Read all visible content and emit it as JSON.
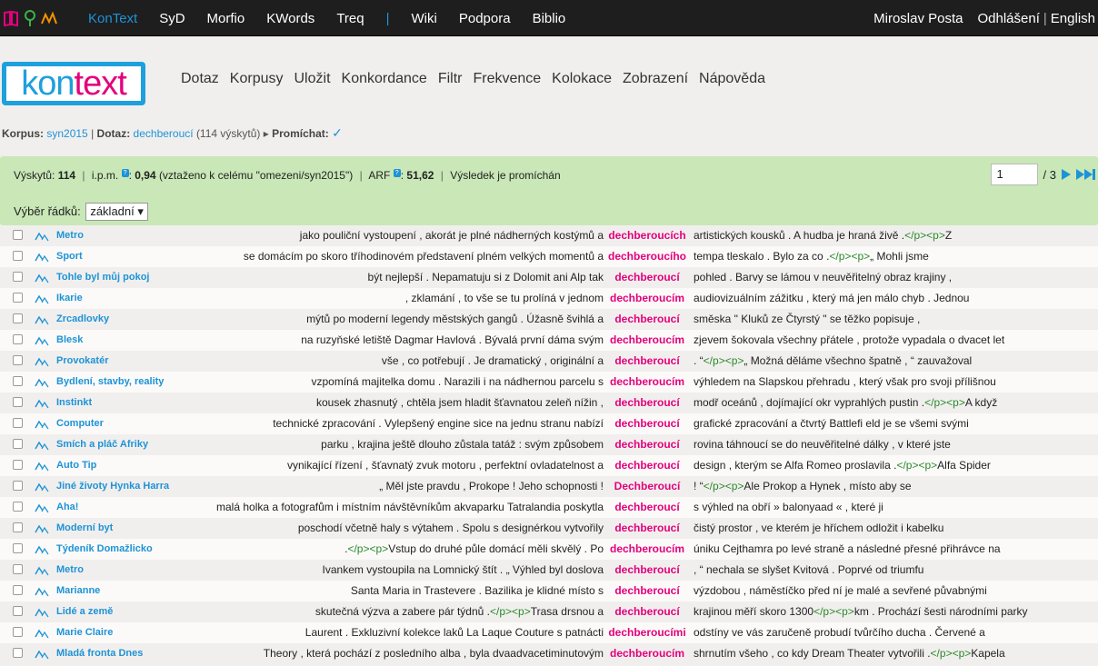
{
  "topbar": {
    "nav": [
      {
        "label": "KonText",
        "active": true
      },
      {
        "label": "SyD",
        "active": false
      },
      {
        "label": "Morfio",
        "active": false
      },
      {
        "label": "KWords",
        "active": false
      },
      {
        "label": "Treq",
        "active": false
      },
      {
        "label": "|",
        "separator": true
      },
      {
        "label": "Wiki",
        "active": false
      },
      {
        "label": "Podpora",
        "active": false
      },
      {
        "label": "Biblio",
        "active": false
      }
    ],
    "user": "Miroslav Posta",
    "logout": "Odhlášení",
    "pipe": "|",
    "language": "English"
  },
  "brand": {
    "kon": "kon",
    "text": "text"
  },
  "menu": [
    "Dotaz",
    "Korpusy",
    "Uložit",
    "Konkordance",
    "Filtr",
    "Frekvence",
    "Kolokace",
    "Zobrazení",
    "Nápověda"
  ],
  "breadcrumb": {
    "corpus_label": "Korpus:",
    "corpus": "syn2015",
    "query_label": "Dotaz:",
    "query": "dechberoucí",
    "query_count": "(114 výskytů)",
    "shuffle_label": "Promíchat:",
    "shuffle_mark": "✓"
  },
  "summary": {
    "hits_label": "Výskytů:",
    "hits": "114",
    "ipm_label": "i.p.m.",
    "ipm": "0,94",
    "ipm_note": "(vztaženo k celému \"omezeni/syn2015\")",
    "arf_label": "ARF",
    "arf": "51,62",
    "shuffled": "Výsledek je promíchán",
    "line_select_label": "Výběr řádků:",
    "line_select_value": "základní ▾"
  },
  "pager": {
    "current": "1",
    "total": "/ 3"
  },
  "rows": [
    {
      "ref": "Metro",
      "left": "jako pouliční vystoupení , akorát je plné nádherných kostýmů a",
      "kwic": "dechberoucích",
      "right": "artistických kousků . A hudba je hraná živě .</p><p>Z"
    },
    {
      "ref": "Sport",
      "left": "se domácím po skoro tříhodinovém představení plném velkých momentů a",
      "kwic": "dechberoucího",
      "right": "tempa tleskalo . Bylo za co .</p><p>„ Mohli jsme"
    },
    {
      "ref": "Tohle byl můj pokoj",
      "left": "být nejlepší . Nepamatuju si z Dolomit ani Alp tak",
      "kwic": "dechberoucí",
      "right": "pohled . Barvy se lámou v neuvěřitelný obraz krajiny ,"
    },
    {
      "ref": "Ikarie",
      "left": ", zklamání , to vše se tu prolíná v jednom",
      "kwic": "dechberoucím",
      "right": "audiovizuálním zážitku , který má jen málo chyb . Jednou"
    },
    {
      "ref": "Zrcadlovky",
      "left": "mýtů po moderní legendy městských gangů . Úžasně švihlá a",
      "kwic": "dechberoucí",
      "right": "směska \" Kluků ze Čtyrstý \" se těžko popisuje ,"
    },
    {
      "ref": "Blesk",
      "left": "na ruzyňské letiště Dagmar Havlová . Bývalá první dáma svým",
      "kwic": "dechberoucím",
      "right": "zjevem šokovala všechny přátele , protože vypadala o dvacet let"
    },
    {
      "ref": "Provokatér",
      "left": "vše , co potřebují . Je dramatický , originální a",
      "kwic": "dechberoucí",
      "right": ". “</p><p>„ Možná děláme všechno špatně , “ zauvažoval"
    },
    {
      "ref": "Bydlení, stavby, reality",
      "left": "vzpomíná majitelka domu . Narazili i na nádhernou parcelu s",
      "kwic": "dechberoucím",
      "right": "výhledem na Slapskou přehradu , který však pro svoji přílišnou"
    },
    {
      "ref": "Instinkt",
      "left": "kousek zhasnutý , chtěla jsem hladit šťavnatou zeleň nížin ,",
      "kwic": "dechberoucí",
      "right": "modř oceánů , dojímající okr vyprahlých pustin .</p><p>A když"
    },
    {
      "ref": "Computer",
      "left": "technické zpracování . Vylepšený engine sice na jednu stranu nabízí",
      "kwic": "dechberoucí",
      "right": "grafické zpracování a čtvrtý Battlefi eld je se všemi svými"
    },
    {
      "ref": "Smích a pláč Afriky",
      "left": "parku , krajina ještě dlouho zůstala tatáž : svým způsobem",
      "kwic": "dechberoucí",
      "right": "rovina táhnoucí se do neuvěřitelné dálky , v které jste"
    },
    {
      "ref": "Auto Tip",
      "left": "vynikající řízení , šťavnatý zvuk motoru , perfektní ovladatelnost a",
      "kwic": "dechberoucí",
      "right": "design , kterým se Alfa Romeo proslavila .</p><p>Alfa Spider"
    },
    {
      "ref": "Jiné životy Hynka Harra",
      "left": "„ Měl jste pravdu , Prokope ! Jeho schopnosti !",
      "kwic": "Dechberoucí",
      "right": "! “</p><p>Ale Prokop a Hynek , místo aby se"
    },
    {
      "ref": "Aha!",
      "left": "malá holka a fotografům i místním návštěvníkům akvaparku Tatralandia poskytla",
      "kwic": "dechberoucí",
      "right": "s výhled na obří » balonyaad « , které ji"
    },
    {
      "ref": "Moderní byt",
      "left": "poschodí včetně haly s výtahem . Spolu s designérkou vytvořily",
      "kwic": "dechberoucí",
      "right": "čistý prostor , ve kterém je hříchem odložit i kabelku"
    },
    {
      "ref": "Týdeník Domažlicko",
      "left": ".</p><p>Vstup do druhé půle domácí měli skvělý . Po",
      "kwic": "dechberoucím",
      "right": "úniku Cejthamra po levé straně a následné přesné přihrávce na"
    },
    {
      "ref": "Metro",
      "left": "Ivankem vystoupila na Lomnický štít . „ Výhled byl doslova",
      "kwic": "dechberoucí",
      "right": ", “ nechala se slyšet Kvitová . Poprvé od triumfu"
    },
    {
      "ref": "Marianne",
      "left": "Santa Maria in Trastevere . Bazilika je klidné místo s",
      "kwic": "dechberoucí",
      "right": "výzdobou , náměstíčko před ní je malé a sevřené půvabnými"
    },
    {
      "ref": "Lidé a země",
      "left": "skutečná výzva a zabere pár týdnů .</p><p>Trasa drsnou a",
      "kwic": "dechberoucí",
      "right": "krajinou měří skoro 1300</p><p>km . Prochází šesti národními parky"
    },
    {
      "ref": "Marie Claire",
      "left": "Laurent . Exkluzivní kolekce laků La Laque Couture s patnácti",
      "kwic": "dechberoucími",
      "right": "odstíny ve vás zaručeně probudí tvůrčího ducha . Červené a"
    },
    {
      "ref": "Mladá fronta Dnes",
      "left": "Theory , která pochází z posledního alba , byla dvaadvacetiminutovým",
      "kwic": "dechberoucím",
      "right": "shrnutím všeho , co kdy Dream Theater vytvořili .</p><p>Kapela"
    }
  ],
  "colors": {
    "accent": "#1e93d6",
    "kwic": "#e4007c",
    "tag": "#2a8a2a",
    "panel": "#c9e7b7"
  }
}
